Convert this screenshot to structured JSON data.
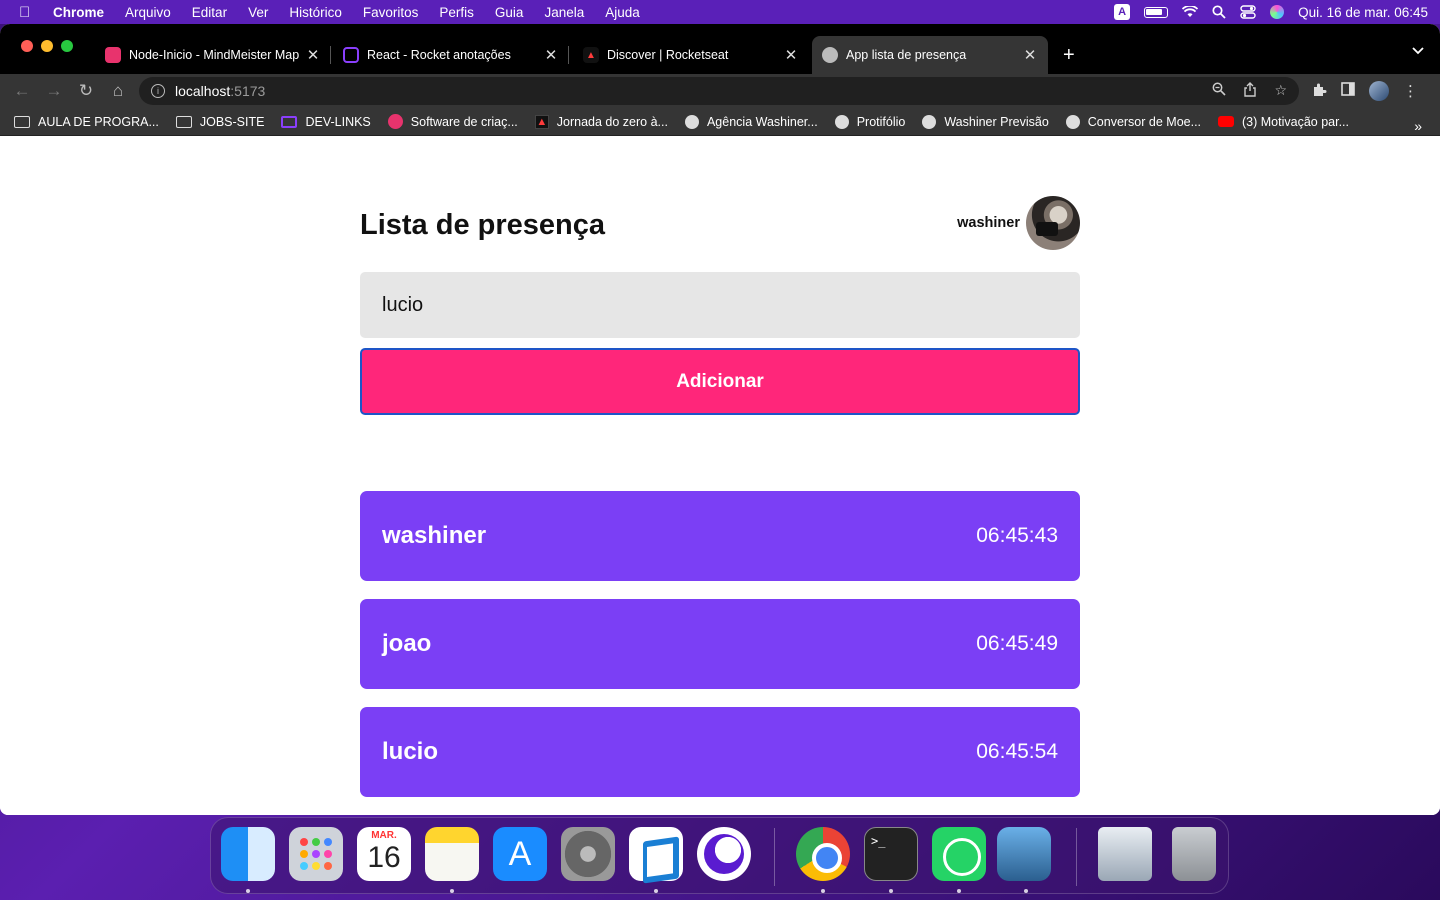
{
  "menubar": {
    "app_name": "Chrome",
    "items": [
      "Arquivo",
      "Editar",
      "Ver",
      "Histórico",
      "Favoritos",
      "Perfis",
      "Guia",
      "Janela",
      "Ajuda"
    ],
    "input_source": "A",
    "clock": "Qui. 16 de mar.  06:45"
  },
  "browser": {
    "tabs": [
      {
        "title": "Node-Inicio - MindMeister Map",
        "favicon": "mindmeister-icon"
      },
      {
        "title": "React - Rocket anotações",
        "favicon": "purple-monitor-icon"
      },
      {
        "title": "Discover | Rocketseat",
        "favicon": "rocketseat-icon"
      },
      {
        "title": "App lista de presença",
        "favicon": "globe-icon"
      }
    ],
    "url_host": "localhost",
    "url_port": ":5173",
    "bookmarks": [
      {
        "label": "AULA DE PROGRA...",
        "icon": "folder"
      },
      {
        "label": "JOBS-SITE",
        "icon": "folder"
      },
      {
        "label": "DEV-LINKS",
        "icon": "purple"
      },
      {
        "label": "Software de criaç...",
        "icon": "pink"
      },
      {
        "label": "Jornada do zero à...",
        "icon": "rocket"
      },
      {
        "label": "Agência Washiner...",
        "icon": "globe"
      },
      {
        "label": "Protifólio",
        "icon": "globe"
      },
      {
        "label": "Washiner Previsão",
        "icon": "globe"
      },
      {
        "label": "Conversor de Moe...",
        "icon": "globe"
      },
      {
        "label": "(3) Motivação par...",
        "icon": "yt"
      }
    ]
  },
  "page": {
    "title": "Lista de presença",
    "user_name": "washiner",
    "input_value": "lucio",
    "add_button_label": "Adicionar",
    "attendees": [
      {
        "name": "washiner",
        "time": "06:45:43"
      },
      {
        "name": "joao",
        "time": "06:45:49"
      },
      {
        "name": "lucio",
        "time": "06:45:54"
      }
    ],
    "colors": {
      "button": "#ff267a",
      "card": "#7b3ff5",
      "input_bg": "#e6e6e6"
    }
  },
  "dock": {
    "calendar_month": "MAR.",
    "calendar_day": "16",
    "terminal_prompt": ">_"
  }
}
